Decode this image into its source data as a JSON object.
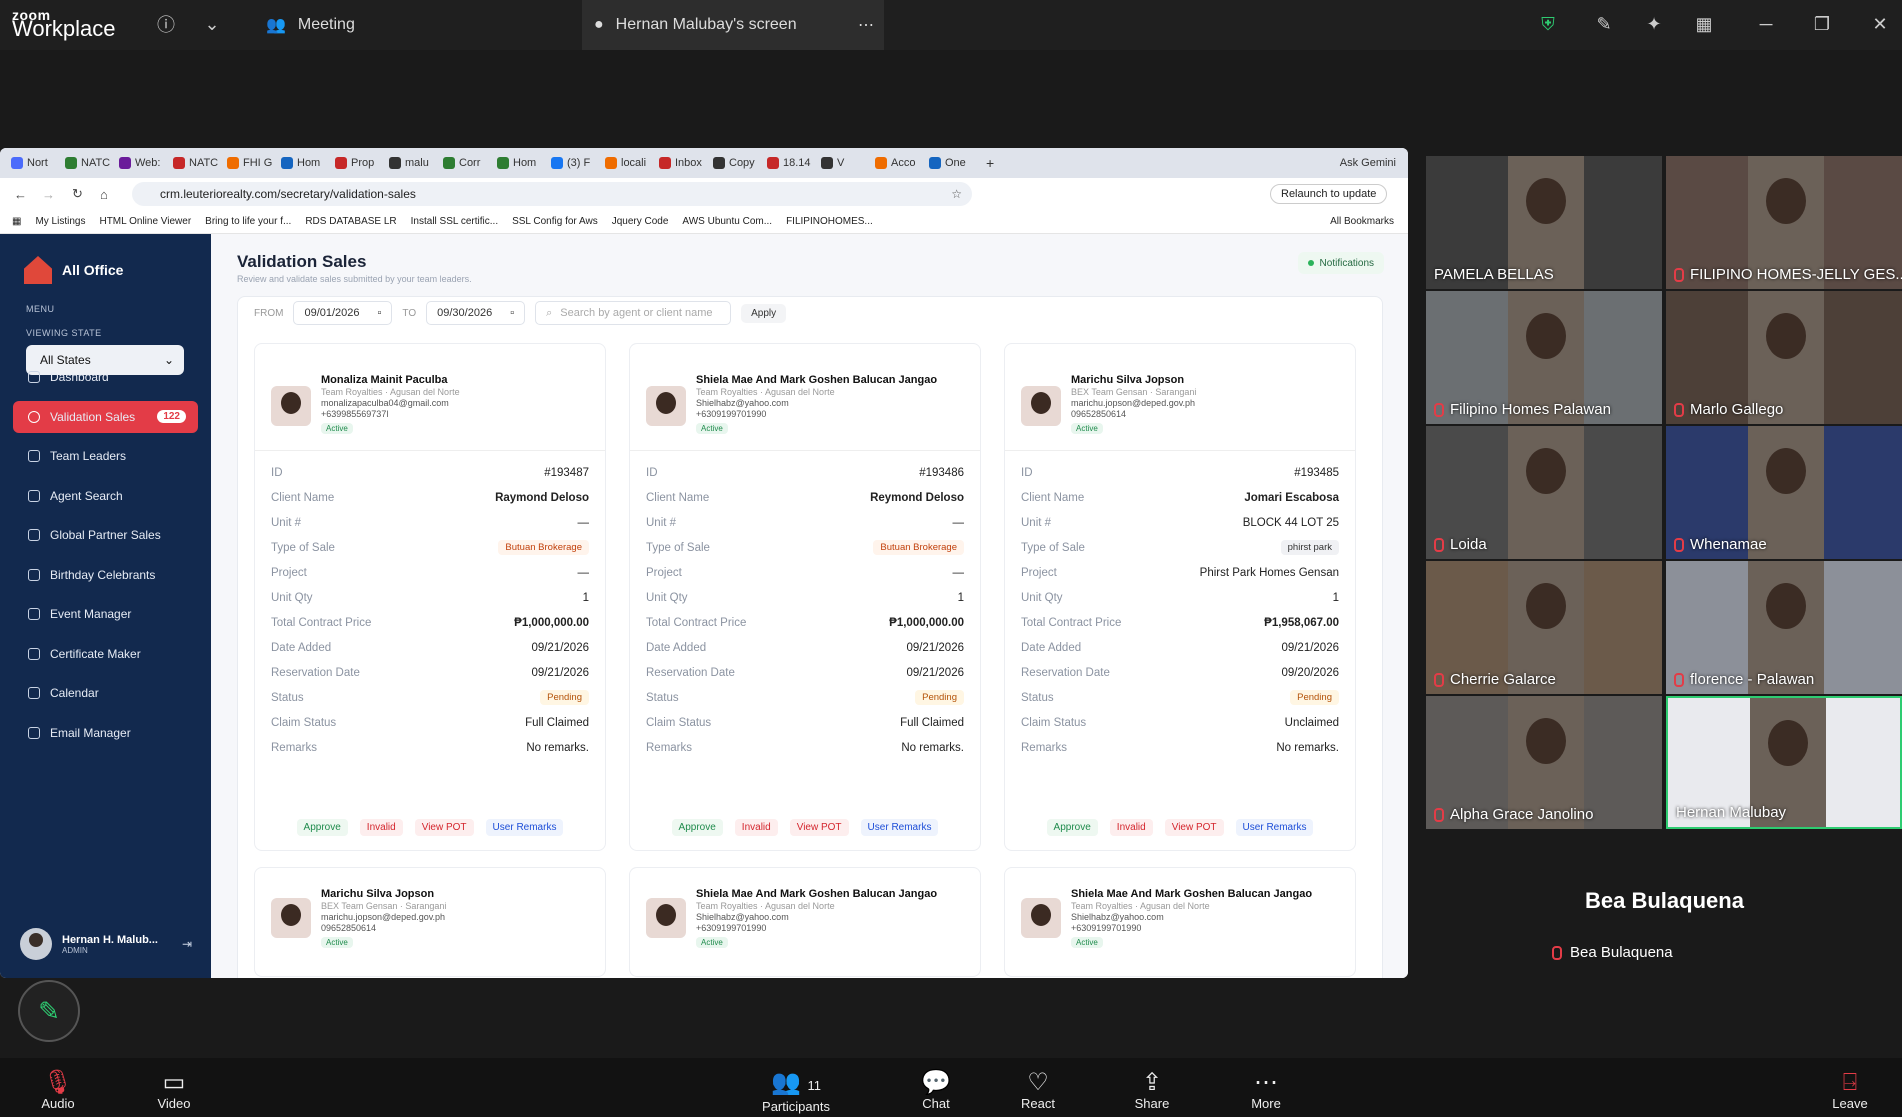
{
  "zoom": {
    "logo_top": "zoom",
    "logo_bottom": "Workplace",
    "meeting": "Meeting",
    "screen": "Hernan Malubay's screen"
  },
  "chrome": {
    "tabs": [
      "Nort",
      "NATC",
      "Web:",
      "NATC",
      "FHI G",
      "Hom",
      "Prop",
      "malu",
      "Corr",
      "Hom",
      "(3) F",
      "locali",
      "Inbox",
      "Copy",
      "18.14",
      "V",
      "Acco",
      "One"
    ],
    "ask": "Ask Gemini",
    "url": "crm.leuteriorealty.com/secretary/validation-sales",
    "relaunch": "Relaunch to update",
    "bookmarks": [
      "My Listings",
      "HTML Online Viewer",
      "Bring to life your f...",
      "RDS DATABASE LR",
      "Install SSL certific...",
      "SSL Config for Aws",
      "Jquery Code",
      "AWS Ubuntu Com...",
      "FILIPINOHOMES..."
    ],
    "all_bookmarks": "All Bookmarks"
  },
  "sidebar": {
    "brand": "All Office",
    "menu": "MENU",
    "viewing": "VIEWING STATE",
    "state": "All States",
    "items": [
      {
        "label": "Dashboard"
      },
      {
        "label": "Validation Sales",
        "badge": "122"
      },
      {
        "label": "Team Leaders"
      },
      {
        "label": "Agent Search"
      },
      {
        "label": "Global Partner Sales"
      },
      {
        "label": "Birthday Celebrants"
      },
      {
        "label": "Event Manager"
      },
      {
        "label": "Certificate Maker"
      },
      {
        "label": "Calendar"
      },
      {
        "label": "Email Manager"
      }
    ],
    "user_name": "Hernan H. Malub...",
    "user_role": "ADMIN"
  },
  "page": {
    "title": "Validation Sales",
    "subtitle": "Review and validate sales submitted by your team leaders.",
    "notifications": "Notifications",
    "from_label": "FROM",
    "from": "09/01/2026",
    "to_label": "TO",
    "to": "09/30/2026",
    "search_placeholder": "Search by agent or client name",
    "apply": "Apply"
  },
  "labels": {
    "id": "ID",
    "client": "Client Name",
    "unit": "Unit #",
    "type": "Type of Sale",
    "project": "Project",
    "qty": "Unit Qty",
    "tcp": "Total Contract Price",
    "added": "Date Added",
    "res": "Reservation Date",
    "status": "Status",
    "claim": "Claim Status",
    "remarks": "Remarks",
    "active": "Active",
    "approve": "Approve",
    "invalid": "Invalid",
    "pot": "View POT",
    "uremarks": "User Remarks"
  },
  "cards": [
    {
      "name": "Monaliza Mainit Paculba",
      "team": "Team Royalties · Agusan del Norte",
      "email": "monalizapaculba04@gmail.com",
      "phone": "+639985569737l",
      "id": "#193487",
      "client": "Raymond Deloso",
      "unit": "—",
      "type": "Butuan Brokerage",
      "project": "—",
      "qty": "1",
      "tcp": "₱1,000,000.00",
      "added": "09/21/2026",
      "res": "09/21/2026",
      "status": "Pending",
      "claim": "Full Claimed",
      "remarks": "No remarks."
    },
    {
      "name": "Shiela Mae And Mark Goshen Balucan Jangao",
      "team": "Team Royalties · Agusan del Norte",
      "email": "Shielhabz@yahoo.com",
      "phone": "+6309199701990",
      "id": "#193486",
      "client": "Reymond Deloso",
      "unit": "—",
      "type": "Butuan Brokerage",
      "project": "—",
      "qty": "1",
      "tcp": "₱1,000,000.00",
      "added": "09/21/2026",
      "res": "09/21/2026",
      "status": "Pending",
      "claim": "Full Claimed",
      "remarks": "No remarks."
    },
    {
      "name": "Marichu Silva Jopson",
      "team": "BEX Team Gensan · Sarangani",
      "email": "marichu.jopson@deped.gov.ph",
      "phone": "09652850614",
      "id": "#193485",
      "client": "Jomari Escabosa",
      "unit": "BLOCK 44 LOT 25",
      "type": "phirst park",
      "project": "Phirst Park Homes Gensan",
      "qty": "1",
      "tcp": "₱1,958,067.00",
      "added": "09/21/2026",
      "res": "09/20/2026",
      "status": "Pending",
      "claim": "Unclaimed",
      "remarks": "No remarks."
    }
  ],
  "cards_row2": [
    {
      "name": "Marichu Silva Jopson",
      "team": "BEX Team Gensan · Sarangani",
      "email": "marichu.jopson@deped.gov.ph",
      "phone": "09652850614"
    },
    {
      "name": "Shiela Mae And Mark Goshen Balucan Jangao",
      "team": "Team Royalties · Agusan del Norte",
      "email": "Shielhabz@yahoo.com",
      "phone": "+6309199701990"
    },
    {
      "name": "Shiela Mae And Mark Goshen Balucan Jangao",
      "team": "Team Royalties · Agusan del Norte",
      "email": "Shielhabz@yahoo.com",
      "phone": "+6309199701990"
    }
  ],
  "participants": [
    "PAMELA BELLAS",
    "FILIPINO HOMES-JELLY GES...",
    "Filipino Homes Palawan",
    "Marlo Gallego",
    "Loida",
    "Whenamae",
    "Cherrie Galarce",
    "florence - Palawan",
    "Alpha Grace Janolino",
    "Hernan Malubay"
  ],
  "bea": "Bea Bulaquena",
  "bottom": {
    "audio": "Audio",
    "video": "Video",
    "participants": "Participants",
    "count": "11",
    "chat": "Chat",
    "react": "React",
    "share": "Share",
    "more": "More",
    "leave": "Leave"
  }
}
